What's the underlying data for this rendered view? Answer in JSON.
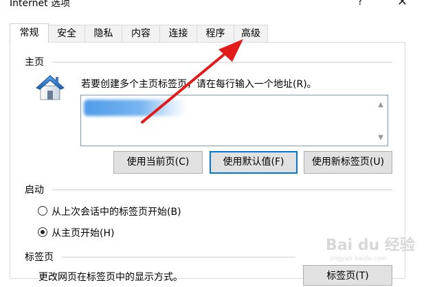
{
  "window": {
    "title": "Internet 选项",
    "help_glyph": "?",
    "close_glyph": "✕"
  },
  "tabs": [
    {
      "label": "常规",
      "active": true
    },
    {
      "label": "安全"
    },
    {
      "label": "隐私"
    },
    {
      "label": "内容"
    },
    {
      "label": "连接"
    },
    {
      "label": "程序"
    },
    {
      "label": "高级"
    }
  ],
  "homepage": {
    "group_title": "主页",
    "hint": "若要创建多个主页标签页，请在每行输入一个地址(R)。",
    "buttons": {
      "current": "使用当前页(C)",
      "default": "使用默认值(F)",
      "new_tab": "使用新标签页(U)"
    }
  },
  "startup": {
    "group_title": "启动",
    "options": [
      {
        "label": "从上次会话中的标签页开始(B)",
        "checked": false
      },
      {
        "label": "从主页开始(H)",
        "checked": true
      }
    ]
  },
  "tabs_section": {
    "group_title": "标签页",
    "hint_partial": "更改网页在标签页中的显示方式。",
    "button": "标签页(T)"
  },
  "watermark": {
    "text": "Bai du 经验",
    "sub": "jingyan.baidu.com"
  },
  "colors": {
    "accent": "#0078d7",
    "arrow": "#e21a1a"
  }
}
